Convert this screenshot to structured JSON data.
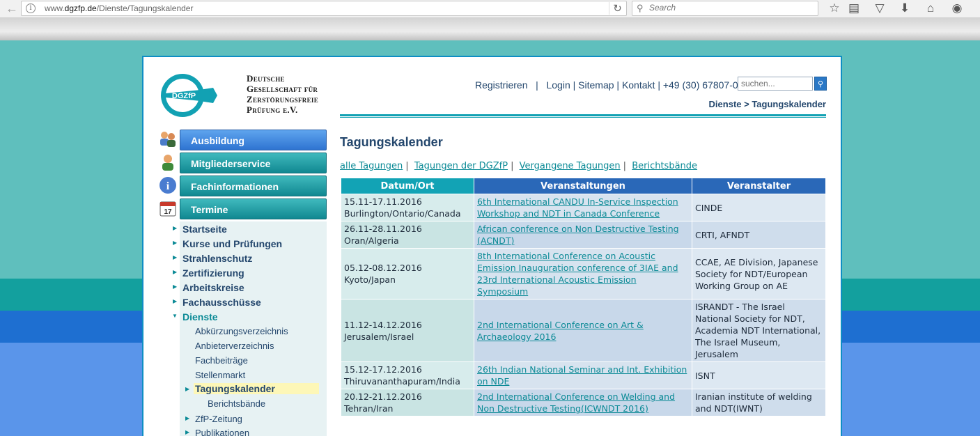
{
  "browser": {
    "url_prefix": "www.",
    "url_host": "dgzfp.de",
    "url_path": "/Dienste/Tagungskalender",
    "search_placeholder": "Search"
  },
  "site": {
    "logo_text": "DGZfP",
    "org_lines": [
      "Deutsche",
      "Gesellschaft für",
      "Zerstörungsfreie",
      "Prüfung e.V."
    ],
    "top_links": [
      "Registrieren",
      "Login",
      "Sitemap",
      "Kontakt",
      "+49 (30) 67807-0"
    ],
    "search_placeholder": "suchen...",
    "breadcrumb": "Dienste > Tagungskalender"
  },
  "menu": [
    {
      "label": "Ausbildung",
      "icon": "people-icon"
    },
    {
      "label": "Mitgliederservice",
      "icon": "person-icon"
    },
    {
      "label": "Fachinformationen",
      "icon": "info-icon"
    },
    {
      "label": "Termine",
      "icon": "calendar-icon",
      "icon_text": "17"
    }
  ],
  "submenu": {
    "items": [
      "Startseite",
      "Kurse und Prüfungen",
      "Strahlenschutz",
      "Zertifizierung",
      "Arbeitskreise",
      "Fachausschüsse",
      "Dienste"
    ],
    "dienste_children": [
      "Abkürzungsverzeichnis",
      "Anbieterverzeichnis",
      "Fachbeiträge",
      "Stellenmarkt",
      "Tagungskalender",
      "Berichtsbände",
      "ZfP-Zeitung",
      "Publikationen"
    ]
  },
  "main": {
    "title": "Tagungskalender",
    "filters": [
      "alle Tagungen",
      "Tagungen der DGZfP",
      "Vergangene Tagungen",
      "Berichtsbände"
    ],
    "columns": [
      "Datum/Ort",
      "Veranstaltungen",
      "Veranstalter"
    ],
    "rows": [
      {
        "date": "15.11-17.11.2016",
        "place": "Burlington/Ontario/Canada",
        "event": "6th International CANDU In-Service Inspection Workshop and NDT in Canada Conference",
        "organizer": "CINDE"
      },
      {
        "date": "26.11-28.11.2016",
        "place": "Oran/Algeria",
        "event": "African conference on Non Destructive Testing (ACNDT)",
        "organizer": "CRTI, AFNDT"
      },
      {
        "date": "05.12-08.12.2016",
        "place": "Kyoto/Japan",
        "event": "8th International Conference on Acoustic Emission Inauguration conference of 3IAE and 23rd International Acoustic Emission Symposium",
        "organizer": "CCAE, AE Division, Japanese Society for NDT/European Working Group on AE"
      },
      {
        "date": "11.12-14.12.2016",
        "place": "Jerusalem/Israel",
        "event": "2nd International Conference on Art & Archaeology 2016",
        "organizer": "ISRANDT - The Israel National Society for NDT, Academia NDT International, The Israel Museum, Jerusalem"
      },
      {
        "date": "15.12-17.12.2016",
        "place": "Thiruvananthapuram/India",
        "event": "26th Indian National Seminar and Int. Exhibition on NDE",
        "organizer": "ISNT"
      },
      {
        "date": "20.12-21.12.2016",
        "place": "Tehran/Iran",
        "event": "2nd International Conference on Welding and Non Destructive Testing(ICWNDT 2016)",
        "organizer": "Iranian institute of welding and NDT(IWNT)"
      }
    ]
  }
}
